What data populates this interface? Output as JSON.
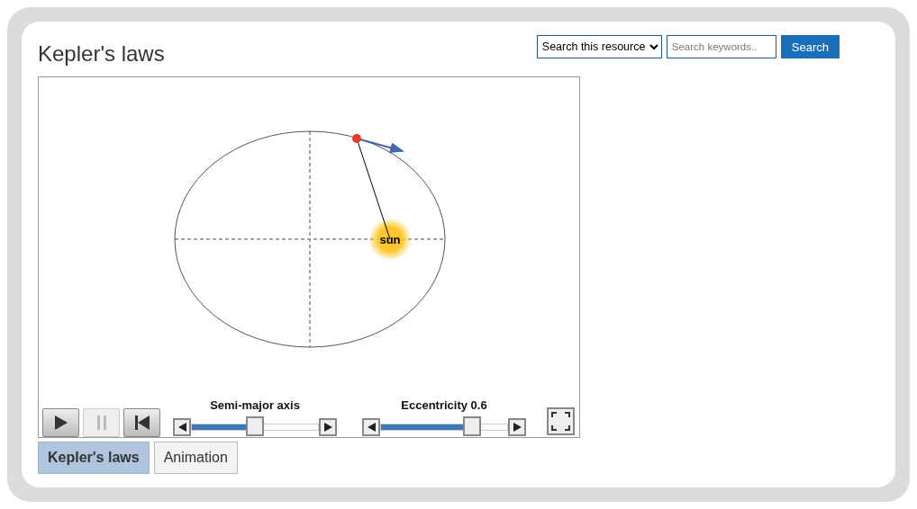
{
  "title": "Kepler's laws",
  "search": {
    "scope": "Search this resource",
    "placeholder": "Search keywords..",
    "button": "Search"
  },
  "simulation": {
    "sun_label": "sun"
  },
  "playback": [
    {
      "kind": "play",
      "disabled": false
    },
    {
      "kind": "pause",
      "disabled": true
    },
    {
      "kind": "reset",
      "disabled": false
    }
  ],
  "sliders": [
    {
      "label": "Semi-major axis",
      "level": 0.5
    },
    {
      "label": "Eccentricity 0.6",
      "level": 0.72
    }
  ],
  "tabs": [
    {
      "label": "Kepler's laws",
      "selected": true
    },
    {
      "label": "Animation",
      "selected": false
    }
  ]
}
